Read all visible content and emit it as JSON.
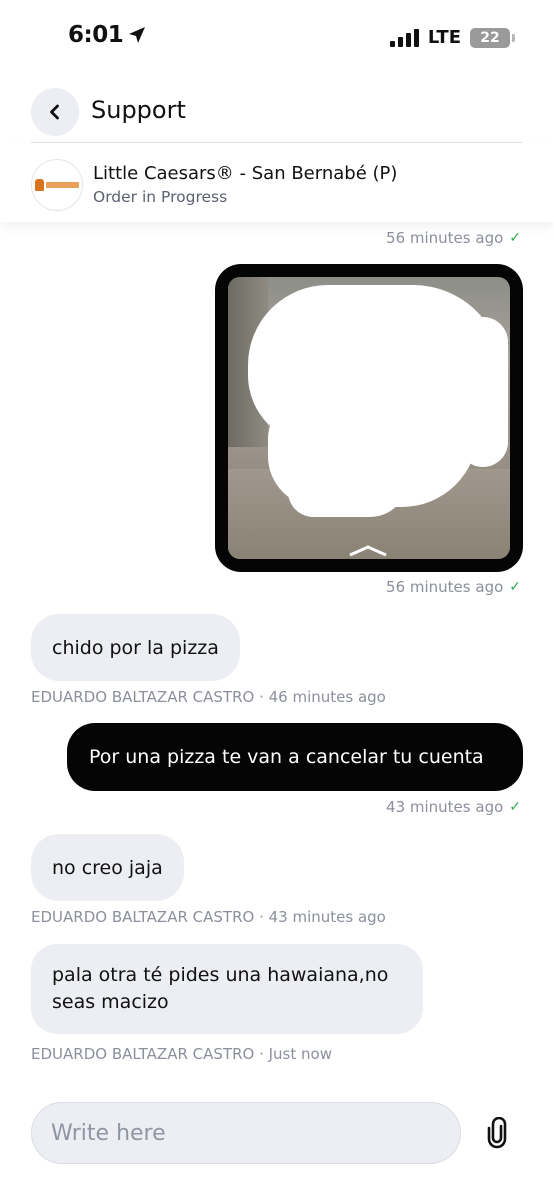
{
  "status_bar": {
    "time": "6:01",
    "network": "LTE",
    "battery": "22"
  },
  "header": {
    "title": "Support"
  },
  "store": {
    "name": "Little Caesars® - San Bernabé (P)",
    "status": "Order in Progress"
  },
  "messages": [
    {
      "type": "outgoing-meta",
      "time": "56 minutes ago"
    },
    {
      "type": "outgoing-image",
      "time": "56 minutes ago"
    },
    {
      "type": "incoming",
      "text": "chido por la pizza",
      "sender": "EDUARDO BALTAZAR CASTRO",
      "time": "46 minutes ago"
    },
    {
      "type": "outgoing",
      "text": "Por una pizza te van a cancelar tu cuenta",
      "time": "43 minutes ago"
    },
    {
      "type": "incoming",
      "text": "no creo jaja",
      "sender": "EDUARDO BALTAZAR CASTRO",
      "time": "43 minutes ago"
    },
    {
      "type": "incoming",
      "text": "pala otra té pides una hawaiana,no seas macizo",
      "sender": "EDUARDO BALTAZAR CASTRO",
      "time": "Just now"
    }
  ],
  "composer": {
    "placeholder": "Write here"
  },
  "icons": {
    "location": "location-arrow-icon",
    "back": "chevron-left-icon",
    "attach": "paperclip-icon",
    "read": "checkmark-icon"
  },
  "colors": {
    "outgoing_bubble": "#050505",
    "incoming_bubble": "#eceef3",
    "read_check": "#34a853"
  }
}
